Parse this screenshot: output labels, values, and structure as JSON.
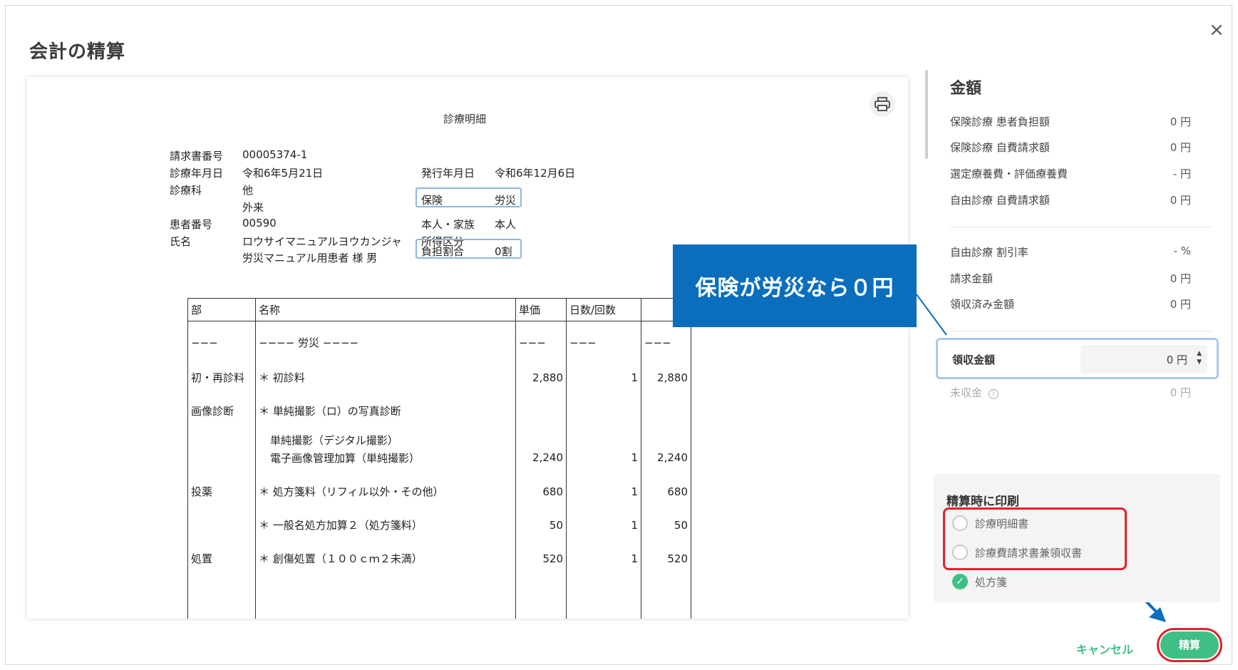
{
  "dialog": {
    "title": "会計の精算",
    "close": "×"
  },
  "document": {
    "title": "診療明細",
    "fields": {
      "invoice_label": "請求書番号",
      "invoice_value": "00005374-1",
      "date_label": "診療年月日",
      "date_value": "令和6年5月21日",
      "issue_label": "発行年月日",
      "issue_value": "令和6年12月6日",
      "dept_label": "診療科",
      "dept_value": "他",
      "visit_value": "外来",
      "insurance_label": "保険",
      "insurance_value": "労災",
      "patient_no_label": "患者番号",
      "patient_no_value": "00590",
      "family_label": "本人・家族",
      "family_value": "本人",
      "name_label": "氏名",
      "name_kana": "ロウサイマニュアルヨウカンジャ",
      "income_label": "所得区分",
      "name_kanji": "労災マニュアル用患者 様 男",
      "burden_label": "負担割合",
      "burden_value": "0割"
    },
    "table": {
      "headers": [
        "部",
        "名称",
        "単価",
        "日数/回数",
        ""
      ],
      "rows": [
        {
          "section": "−−−",
          "name": "−−−− 労災 −−−−",
          "price": "−−−",
          "count": "−−−",
          "total": "−−−"
        },
        {
          "section": "初・再診料",
          "name": "＊ 初診料",
          "price": "2,880",
          "count": "1",
          "total": "2,880"
        },
        {
          "section": "画像診断",
          "name": "＊ 単純撮影（ロ）の写真診断",
          "price": "",
          "count": "",
          "total": ""
        },
        {
          "section": "",
          "name": "単純撮影（デジタル撮影）",
          "price": "",
          "count": "",
          "total": ""
        },
        {
          "section": "",
          "name": "電子画像管理加算（単純撮影）",
          "price": "2,240",
          "count": "1",
          "total": "2,240"
        },
        {
          "section": "投薬",
          "name": "＊ 処方箋料（リフィル以外・その他）",
          "price": "680",
          "count": "1",
          "total": "680"
        },
        {
          "section": "",
          "name": "＊ 一般名処方加算２（処方箋料）",
          "price": "50",
          "count": "1",
          "total": "50"
        },
        {
          "section": "処置",
          "name": "＊ 創傷処置（１００ｃｍ２未満）",
          "price": "520",
          "count": "1",
          "total": "520"
        },
        {
          "section": "",
          "name": "",
          "price": "",
          "count": "",
          "total": ""
        }
      ]
    }
  },
  "amounts": {
    "title": "金額",
    "rows": [
      {
        "label": "保険診療 患者負担額",
        "value": "0 円"
      },
      {
        "label": "保険診療 自費請求額",
        "value": "0 円"
      },
      {
        "label": "選定療養費・評価療養費",
        "value": "- 円"
      },
      {
        "label": "自由診療 自費請求額",
        "value": "0 円"
      }
    ],
    "rows2": [
      {
        "label": "自由診療 割引率",
        "value": "- %"
      },
      {
        "label": "請求金額",
        "value": "0 円"
      },
      {
        "label": "領収済み金額",
        "value": "0 円"
      }
    ],
    "receipt_label": "領収金額",
    "receipt_value": "0 円",
    "unpaid_label": "未収金",
    "unpaid_value": "0 円"
  },
  "print": {
    "title": "精算時に印刷",
    "options": [
      {
        "label": "診療明細書",
        "checked": false
      },
      {
        "label": "診療費請求書兼領収書",
        "checked": false
      },
      {
        "label": "処方箋",
        "checked": true
      }
    ]
  },
  "buttons": {
    "cancel": "キャンセル",
    "settle": "精算"
  },
  "callout": {
    "text": "保険が労災なら０円"
  },
  "colors": {
    "accent_green": "#3fbf86",
    "callout_blue": "#0a6ebd",
    "highlight_red": "#e0212d",
    "highlight_blue": "#8fb6e2"
  }
}
